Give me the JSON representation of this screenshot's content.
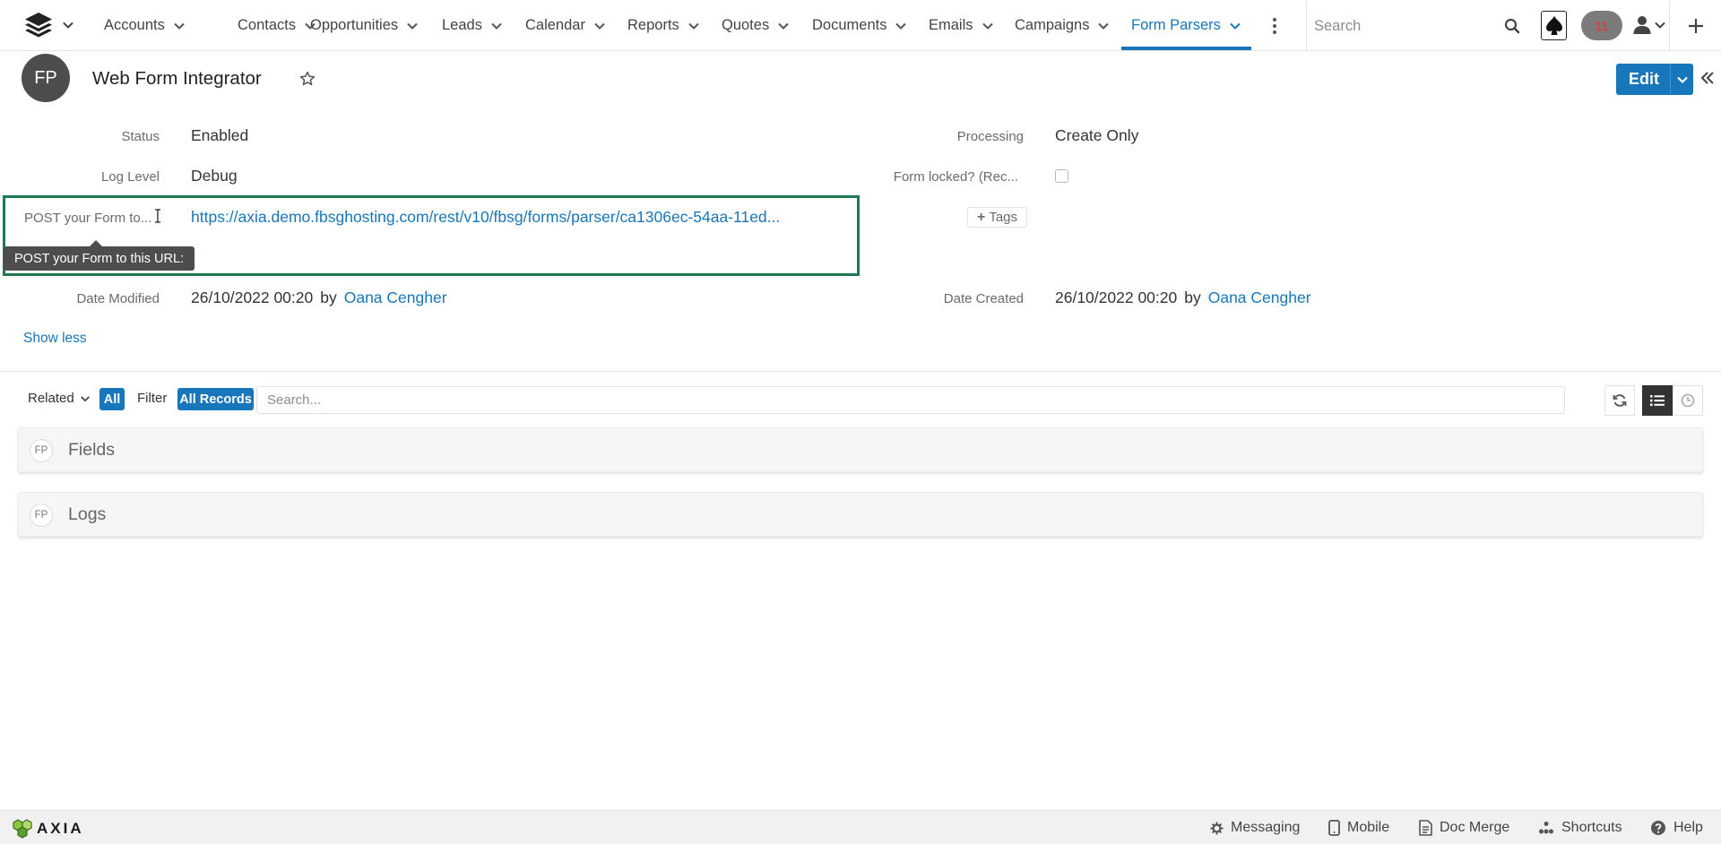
{
  "nav": {
    "logo_icon": "layers-icon",
    "items": [
      {
        "label": "Accounts"
      },
      {
        "label": "Contacts"
      },
      {
        "label": "Opportunities"
      },
      {
        "label": "Leads"
      },
      {
        "label": "Calendar"
      },
      {
        "label": "Reports"
      },
      {
        "label": "Quotes"
      },
      {
        "label": "Documents"
      },
      {
        "label": "Emails"
      },
      {
        "label": "Campaigns"
      },
      {
        "label": "Form Parsers",
        "active": true
      }
    ],
    "search_placeholder": "Search",
    "notification_count": "11",
    "accent_color": "#1876bb"
  },
  "record": {
    "avatar_initials": "FP",
    "title": "Web Form Integrator",
    "edit_label": "Edit"
  },
  "fields": {
    "status_label": "Status",
    "status_value": "Enabled",
    "log_level_label": "Log Level",
    "log_level_value": "Debug",
    "post_url_label": "POST your Form to...",
    "post_url_value": "https://axia.demo.fbsghosting.com/rest/v10/fbsg/forms/parser/ca1306ec-54aa-11ed...",
    "post_url_tooltip": "POST your Form to this URL:",
    "date_modified_label": "Date Modified",
    "date_modified_value": "26/10/2022 00:20",
    "date_modified_by": "Oana Cengher",
    "processing_label": "Processing",
    "processing_value": "Create Only",
    "form_locked_label": "Form locked? (Rec...",
    "form_locked_checked": false,
    "tags_label": "Tags",
    "date_created_label": "Date Created",
    "date_created_value": "26/10/2022 00:20",
    "date_created_by": "Oana Cengher",
    "by_word": "by",
    "show_less": "Show less"
  },
  "related": {
    "related_label": "Related",
    "all_label": "All",
    "filter_label": "Filter",
    "all_records_label": "All Records",
    "search_placeholder": "Search...",
    "subpanels": [
      {
        "badge": "FP",
        "title": "Fields"
      },
      {
        "badge": "FP",
        "title": "Logs"
      }
    ]
  },
  "footer": {
    "brand": "AXIA",
    "items": [
      {
        "label": "Messaging",
        "icon": "gear-icon"
      },
      {
        "label": "Mobile",
        "icon": "mobile-icon"
      },
      {
        "label": "Doc Merge",
        "icon": "document-icon"
      },
      {
        "label": "Shortcuts",
        "icon": "shortcuts-icon"
      },
      {
        "label": "Help",
        "icon": "help-icon"
      }
    ]
  }
}
